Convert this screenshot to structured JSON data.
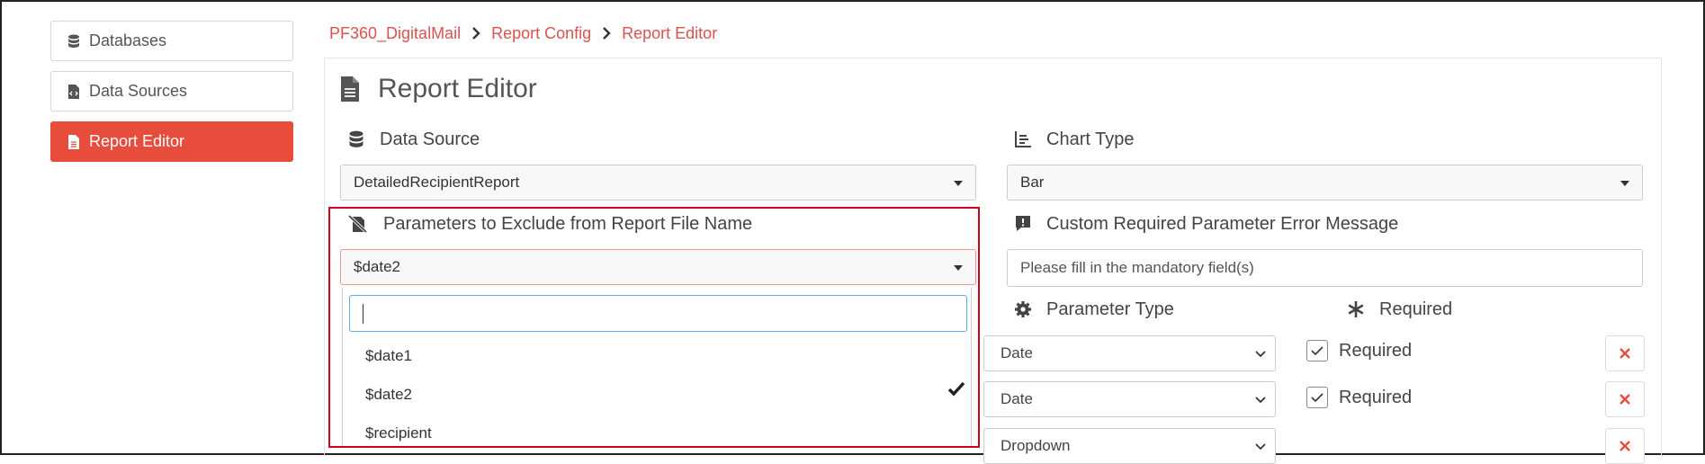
{
  "sidebar": {
    "items": [
      {
        "label": "Databases",
        "icon": "database-icon"
      },
      {
        "label": "Data Sources",
        "icon": "file-code-icon"
      },
      {
        "label": "Report Editor",
        "icon": "file-text-icon",
        "active": true
      }
    ]
  },
  "breadcrumb": [
    "PF360_DigitalMail",
    "Report Config",
    "Report Editor"
  ],
  "page_title": "Report Editor",
  "data_source": {
    "label": "Data Source",
    "value": "DetailedRecipientReport"
  },
  "chart_type": {
    "label": "Chart Type",
    "value": "Bar"
  },
  "exclude_params": {
    "label": "Parameters to Exclude from Report File Name",
    "value": "$date2",
    "search_value": "",
    "options": [
      {
        "label": "$date1",
        "selected": false
      },
      {
        "label": "$date2",
        "selected": true
      },
      {
        "label": "$recipient",
        "selected": false
      }
    ]
  },
  "custom_error": {
    "label": "Custom Required Parameter Error Message",
    "placeholder": "Please fill in the mandatory field(s)"
  },
  "parameter_type_header": "Parameter Type",
  "required_header": "Required",
  "parameter_rows": [
    {
      "type": "Date",
      "required_label": "Required",
      "required": true
    },
    {
      "type": "Date",
      "required_label": "Required",
      "required": true
    },
    {
      "type": "Dropdown",
      "required_label": "",
      "required": false
    }
  ],
  "colors": {
    "accent": "#e74c3c",
    "highlight_border": "#d0021b",
    "focus": "#5dade2"
  }
}
